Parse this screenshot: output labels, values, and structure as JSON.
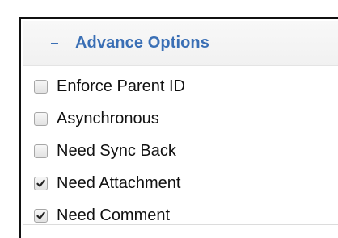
{
  "panel": {
    "title": "Advance Options",
    "toggle_icon": "minus-icon",
    "accent_color": "#3a6fb5"
  },
  "options": [
    {
      "id": "enforce-parent-id",
      "label": "Enforce Parent ID",
      "checked": false
    },
    {
      "id": "asynchronous",
      "label": "Asynchronous",
      "checked": false
    },
    {
      "id": "need-sync-back",
      "label": "Need Sync Back",
      "checked": false
    },
    {
      "id": "need-attachment",
      "label": "Need Attachment",
      "checked": true
    },
    {
      "id": "need-comment",
      "label": "Need Comment",
      "checked": true
    }
  ]
}
